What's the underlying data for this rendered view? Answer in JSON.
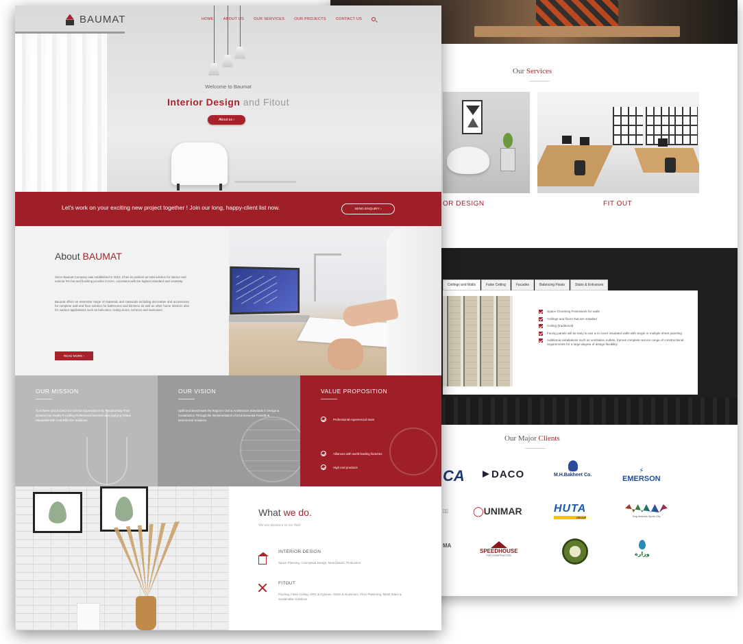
{
  "colors": {
    "accent": "#a7222a",
    "cta_band": "#9e1f27",
    "mission_bg": "#b9b9b9",
    "vision_bg": "#9b9b9b",
    "dark_band": "#1f1f1f"
  },
  "nav": {
    "brand": "BAUMAT",
    "items": [
      "HOME",
      "ABOUT US",
      "OUR SERVICES",
      "OUR PROJECTS",
      "CONTACT US"
    ],
    "search_icon": "search-icon"
  },
  "hero": {
    "welcome": "Welcome to Baumat",
    "headline_accent": "Interior Design",
    "headline_rest": "and Fitout",
    "button": "About us"
  },
  "cta": {
    "text": "Let's work on your exciting new project together ! Join our long, happy-client list now.",
    "button": "SEND ENQUIRY"
  },
  "about": {
    "title_plain": "About",
    "title_accent": "BAUMAT",
    "p1": "Since Baumat Company was established in 2016, it has its position as total solution for interior and exterior Fit-Out and finishing provider in KSA, consistent with the highest standard and creativity.",
    "p2": "Baumat offers an extensive range of materials and classicals including decorative and accessories for complete wall and floor solution for bathrooms and kitchens as well as other home interiors also for outdoor applications such as balconies, ceiling doors, terraces and staircases.",
    "button": "READ MORE"
  },
  "mission": {
    "title": "OUR MISSION",
    "text": "To Achieve and Exceed Our Clients' Expectations By Transforming Their Dreams Into Reality Providing Professional Services and Applying Global Standards with Cost-Effective Solutions."
  },
  "vision": {
    "title": "OUR VISION",
    "text": "Uplift and Benchmark the Region's Civil & Architecture Standards in Design & Construction Through the Implementation of Environmental Friendly & Economical Solutions."
  },
  "value": {
    "title": "VALUE PROPOSITION",
    "items": [
      "Professional experienced team",
      "Alliances with world leading factories",
      "High end products"
    ]
  },
  "whatwedo": {
    "title_plain": "What",
    "title_accent": "we do.",
    "subtitle": "We are pleasure to our field",
    "services": [
      {
        "title": "INTERIOR DESIGN",
        "text": "Space Planning, Conceptual Design, Mood Board, Production"
      },
      {
        "title": "FITOUT",
        "text": "Flooring, False Ceiling, GRC & Gypsum, Glass & Aluminium, Floor Plastering, Metal Stairs & Sustainable Solutions"
      }
    ]
  },
  "services_page": {
    "title_plain": "Our",
    "title_accent": "Services",
    "cards": [
      "OR DESIGN",
      "FIT OUT"
    ]
  },
  "tabs": {
    "labels": [
      "Ceilings and Walls",
      "False Ceiling",
      "Facades",
      "Balancing Floats",
      "Stairs & Entrances"
    ],
    "active": 0,
    "items": [
      "Space Grooming Framework for walls",
      "Ceilings and floors that are installed",
      "Ceiling (traditional)",
      "Facing panels will be easy to use & to cover insulated walls with single or multiple sheet paneling",
      "Additional installations such as ventilation outlets, frames complete service range of constructional requirements for a large degree of design flexibility"
    ]
  },
  "clients": {
    "title_plain": "Our Major",
    "title_accent": "Clients",
    "logos": {
      "ca": "CA",
      "daco": "DACO",
      "bakheet": "M.H.Bakheet Co.",
      "emerson": "EMERSON",
      "unimar": "UNIMAR",
      "huta": "HUTA",
      "huta_sub": "GROUP",
      "kau_sub": "King Abdullah Sports City",
      "ma": "MA",
      "speedhouse": "SPEEDHOUSE",
      "speedhouse_sub": "FOR CONSTRUCTION"
    }
  }
}
